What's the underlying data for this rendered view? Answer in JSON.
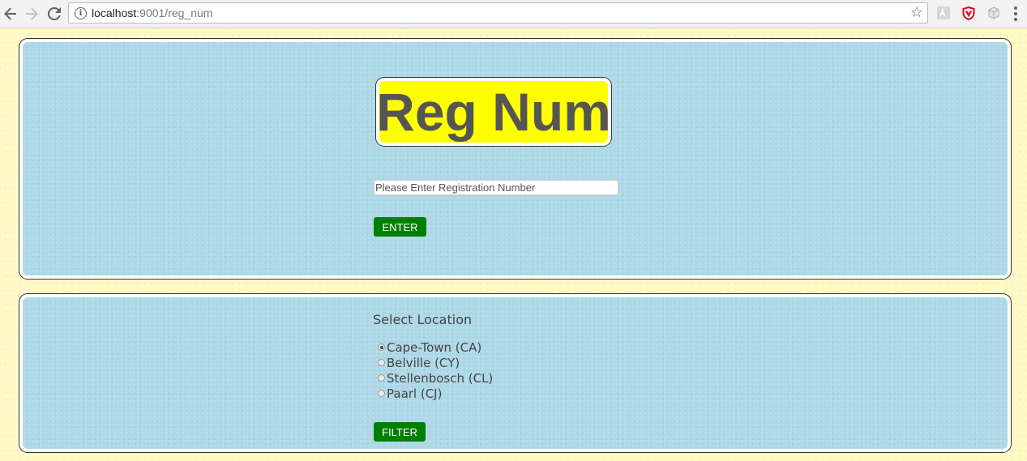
{
  "browser": {
    "url_host": "localhost",
    "url_path": ":9001/reg_num",
    "icons": [
      "back-icon",
      "forward-icon",
      "reload-icon",
      "info-icon",
      "star-icon",
      "pdf-extension-icon",
      "shield-extension-icon",
      "box-extension-icon",
      "menu-icon"
    ]
  },
  "header": {
    "title": "Reg Num"
  },
  "registration": {
    "placeholder": "Please Enter Registration Number",
    "enter_label": "ENTER"
  },
  "location": {
    "heading": "Select Location",
    "options": [
      {
        "label": "Cape-Town (CA)",
        "checked": true
      },
      {
        "label": "Belville (CY)",
        "checked": false
      },
      {
        "label": "Stellenbosch (CL)",
        "checked": false
      },
      {
        "label": "Paarl (CJ)",
        "checked": false
      }
    ],
    "filter_label": "FILTER"
  },
  "colors": {
    "page_background": "#fff9c4",
    "panel_background": "#add8e6",
    "title_background": "#ffff00",
    "button_background": "#008000"
  }
}
